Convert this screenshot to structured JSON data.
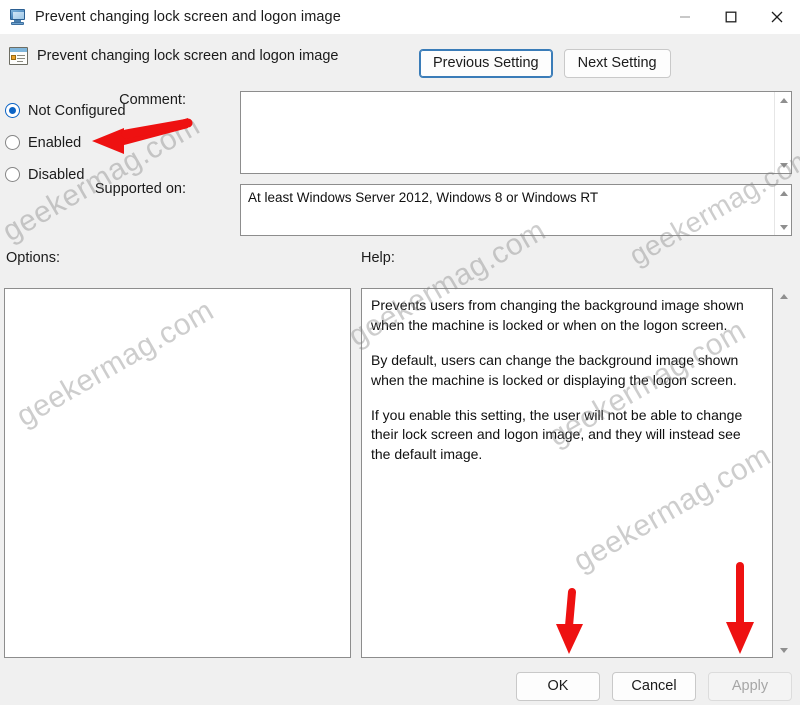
{
  "window": {
    "title": "Prevent changing lock screen and logon image",
    "icon": "monitor-policy-icon",
    "controls": {
      "minimize": "minimize-icon",
      "maximize": "maximize-icon",
      "close": "close-icon"
    }
  },
  "header": {
    "title": "Prevent changing lock screen and logon image",
    "icon": "policy-setting-icon"
  },
  "nav": {
    "previous_label": "Previous Setting",
    "next_label": "Next Setting",
    "focused": "previous"
  },
  "state_options": {
    "selected": "Not Configured",
    "items": [
      {
        "label": "Not Configured",
        "checked": true
      },
      {
        "label": "Enabled",
        "checked": false
      },
      {
        "label": "Disabled",
        "checked": false
      }
    ]
  },
  "comment": {
    "label": "Comment:",
    "value": "",
    "placeholder": ""
  },
  "supported_on": {
    "label": "Supported on:",
    "value": "At least Windows Server 2012, Windows 8 or Windows RT"
  },
  "options": {
    "label": "Options:",
    "value": ""
  },
  "help": {
    "label": "Help:",
    "paragraphs": [
      "Prevents users from changing the background image shown when the machine is locked or when on the logon screen.",
      "By default, users can change the background image shown when the machine is locked or displaying the logon screen.",
      "If you enable this setting, the user will not be able to change their lock screen and logon image, and they will instead see the default image."
    ]
  },
  "dialog_buttons": {
    "ok_label": "OK",
    "cancel_label": "Cancel",
    "apply_label": "Apply",
    "apply_disabled": true
  },
  "annotations": {
    "arrow_color": "#ee1111",
    "arrows": [
      {
        "name": "arrow-pointing-to-enabled",
        "direction": "left",
        "target": "Enabled"
      },
      {
        "name": "arrow-pointing-to-ok",
        "direction": "down",
        "target": "OK"
      },
      {
        "name": "arrow-pointing-to-apply",
        "direction": "down",
        "target": "Apply"
      }
    ]
  },
  "watermarks": {
    "text": "geekermag.com",
    "instances": [
      "geekermag.com",
      "geekermag.com",
      "geekermag.com",
      "geekermag.com",
      "geekermag.com",
      "geekermag.com"
    ]
  },
  "colors": {
    "accent": "#0b63c5",
    "dialog_bg": "#f0f0f0",
    "field_bg": "#ffffff",
    "annotation_red": "#ee1111",
    "focus_border": "#3a7cb8"
  }
}
